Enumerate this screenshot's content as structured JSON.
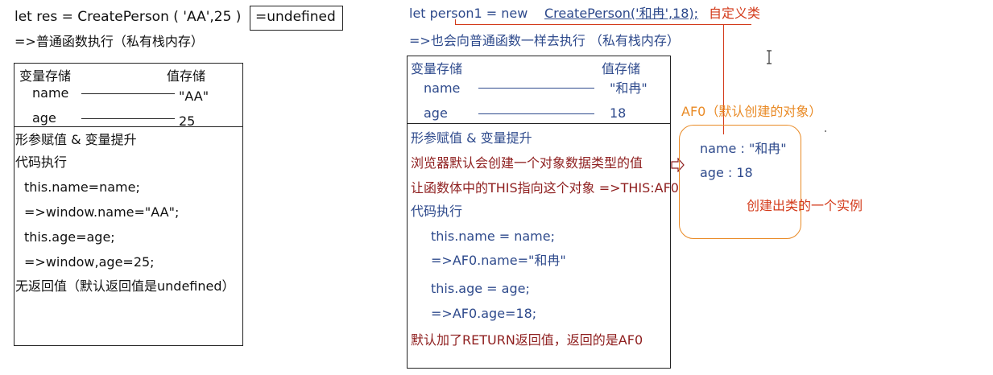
{
  "left": {
    "code_line": "let res =   CreatePerson ( 'AA',25 )",
    "result_box": "=undefined",
    "note": "=>普通函数执行（私有栈内存）",
    "table": {
      "var_header": "变量存储",
      "val_header": "值存储",
      "rows": [
        {
          "name": "name",
          "value": "\"AA\""
        },
        {
          "name": "age",
          "value": "25"
        }
      ]
    },
    "steps": [
      "形参赋值 & 变量提升",
      "代码执行",
      "this.name=name;",
      "=>window.name=\"AA\";",
      "this.age=age;",
      "=>window,age=25;",
      "无返回值（默认返回值是undefined）"
    ]
  },
  "right": {
    "code_prefix": "let person1 = new ",
    "code_call": "CreatePerson('和冉',18);",
    "custom_class_label": "自定义类",
    "note": "=>也会向普通函数一样去执行 （私有栈内存）",
    "table": {
      "var_header": "变量存储",
      "val_header": "值存储",
      "rows": [
        {
          "name": "name",
          "value": "\"和冉\""
        },
        {
          "name": "age",
          "value": "18"
        }
      ]
    },
    "steps": [
      {
        "text": "形参赋值 & 变量提升",
        "color": "blue"
      },
      {
        "text": "浏览器默认会创建一个对象数据类型的值",
        "color": "red"
      },
      {
        "text": "让函数体中的THIS指向这个对象 =>THIS:AF0",
        "color": "red"
      },
      {
        "text": "代码执行",
        "color": "blue"
      },
      {
        "text": "this.name = name;",
        "color": "blue"
      },
      {
        "text": "=>AF0.name=\"和冉\"",
        "color": "blue"
      },
      {
        "text": "this.age = age;",
        "color": "blue"
      },
      {
        "text": "=>AF0.age=18;",
        "color": "blue"
      },
      {
        "text": "默认加了RETURN返回值，返回的是AF0",
        "color": "red"
      }
    ]
  },
  "heap": {
    "label": "AF0（默认创建的对象）",
    "props": [
      "name : \"和冉\"",
      "age : 18"
    ],
    "instance_note": "创建出类的一个实例"
  },
  "colors": {
    "blue": "#2e4a8c",
    "red": "#8e1e1e",
    "annotation_red": "#d33a1a",
    "orange": "#e98a25",
    "ink": "#111111"
  }
}
